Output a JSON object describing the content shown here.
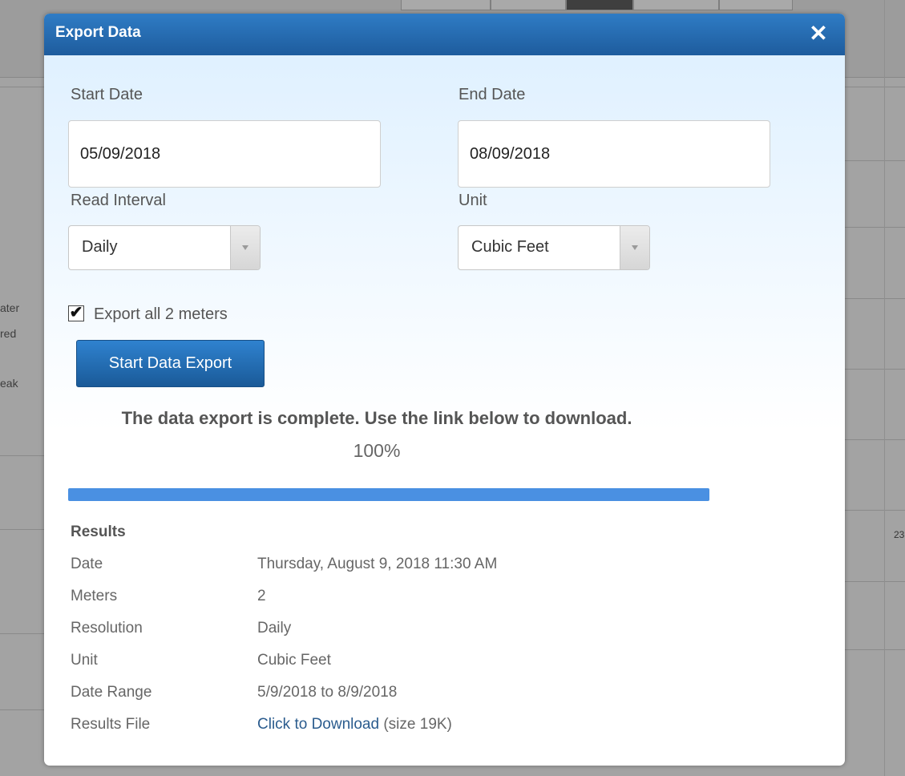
{
  "dialog": {
    "title": "Export Data"
  },
  "form": {
    "start_date_label": "Start Date",
    "start_date_value": "05/09/2018",
    "end_date_label": "End Date",
    "end_date_value": "08/09/2018",
    "read_interval_label": "Read Interval",
    "read_interval_value": "Daily",
    "unit_label": "Unit",
    "unit_value": "Cubic Feet",
    "export_all_label": "Export all 2 meters",
    "export_all_checked": true,
    "start_export_label": "Start Data Export"
  },
  "status": {
    "message": "The data export is complete. Use the link below to download.",
    "percent_text": "100%",
    "progress_value": 1.0
  },
  "results": {
    "title": "Results",
    "rows": [
      {
        "key": "Date",
        "value": "Thursday, August 9, 2018 11:30 AM"
      },
      {
        "key": "Meters",
        "value": "2"
      },
      {
        "key": "Resolution",
        "value": "Daily"
      },
      {
        "key": "Unit",
        "value": "Cubic Feet"
      },
      {
        "key": "Date Range",
        "value": "5/9/2018 to 8/9/2018"
      }
    ],
    "file_label": "Results File",
    "download_link": "Click to Download",
    "file_size": "(size 19K)"
  },
  "background": {
    "edge_text_1": "ater",
    "edge_text_2": "red",
    "edge_text_3": "eak",
    "axis_tick": "23"
  },
  "colors": {
    "header": "#2f7cc5",
    "progress": "#4a90e2",
    "link": "#2b5c8e"
  }
}
